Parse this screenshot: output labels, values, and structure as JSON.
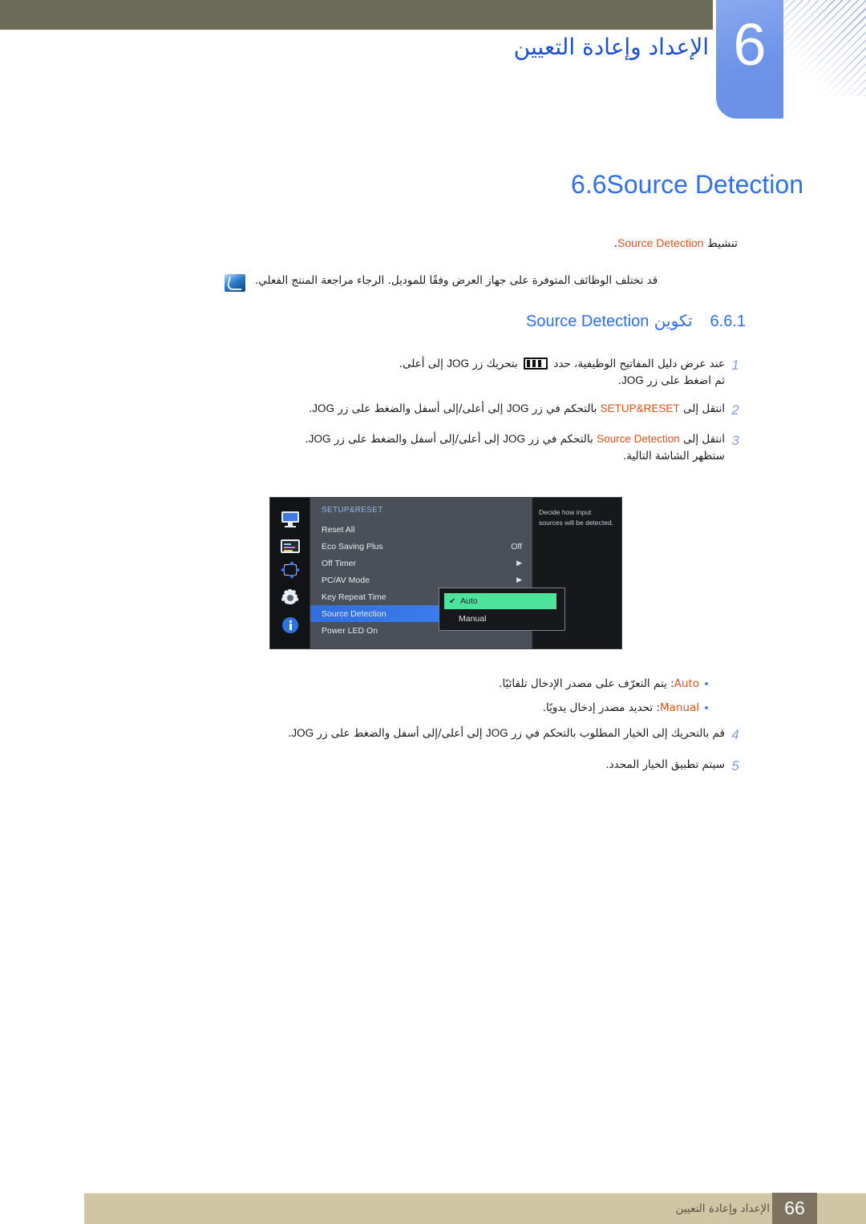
{
  "header": {
    "chapter_number": "6",
    "chapter_title": "الإعداد وإعادة التعيين"
  },
  "section": {
    "number": "6.6",
    "title_en": "Source Detection",
    "subtitle_ar": "تنشيط",
    "subtitle_en": "Source Detection",
    "subtitle_period": "."
  },
  "note": {
    "icon": "note-icon",
    "text": "قد تختلف الوظائف المتوفرة على جهاز العرض وفقًا للموديل. الرجاء مراجعة المنتج الفعلي."
  },
  "subsection": {
    "number": "6.6.1",
    "title_ar": "تكوين",
    "title_en": "Source Detection"
  },
  "steps_top": [
    {
      "num": "1",
      "line1_a": "عند عرض دليل المفاتيح الوظيفية، حدد",
      "line1_b": "بتحريك زر",
      "line1_en": "JOG",
      "line1_c": "إلى أعلى.",
      "line2_a": "ثم اضغط على زر",
      "line2_en": "JOG",
      "line2_b": "."
    },
    {
      "num": "2",
      "line1_a": "انتقل إلى",
      "line1_hi": "SETUP&RESET",
      "line1_b": "بالتحكم في زر",
      "line1_en": "JOG",
      "line1_c": "إلى أعلى/إلى أسفل والضغط على زر",
      "line1_en2": "JOG",
      "line1_d": "."
    },
    {
      "num": "3",
      "line1_a": "انتقل إلى",
      "line1_hi": "Source Detection",
      "line1_b": "بالتحكم في زر",
      "line1_en": "JOG",
      "line1_c": "إلى أعلى/إلى أسفل والضغط على زر",
      "line1_en2": "JOG",
      "line1_d": ".",
      "line2": "ستظهر الشاشة التالية."
    }
  ],
  "osd": {
    "sidebar_icons": [
      "monitor-icon",
      "picture-list-icon",
      "size-position-icon",
      "gear-icon",
      "info-icon"
    ],
    "menu_title": "SETUP&RESET",
    "rows": [
      {
        "label": "Reset All",
        "value": "",
        "arrow": false,
        "selected": false
      },
      {
        "label": "Eco Saving Plus",
        "value": "Off",
        "arrow": false,
        "selected": false
      },
      {
        "label": "Off Timer",
        "value": "",
        "arrow": true,
        "selected": false
      },
      {
        "label": "PC/AV Mode",
        "value": "",
        "arrow": true,
        "selected": false
      },
      {
        "label": "Key Repeat Time",
        "value": "",
        "arrow": false,
        "selected": false
      },
      {
        "label": "Source Detection",
        "value": "",
        "arrow": false,
        "selected": true
      },
      {
        "label": "Power LED On",
        "value": "",
        "arrow": false,
        "selected": false
      }
    ],
    "arrow_glyph": "▶",
    "check_glyph": "✔",
    "popup": [
      {
        "label": "Auto",
        "checked": true
      },
      {
        "label": "Manual",
        "checked": false
      }
    ],
    "help_text": "Decide how input sources will be detected."
  },
  "bullets": [
    {
      "marker": "•",
      "label_en": "Auto",
      "text_ar": ": يتم التعرّف على مصدر الإدخال تلقائيًا."
    },
    {
      "marker": "•",
      "label_en": "Manual",
      "text_ar": ": تحديد مصدر إدخال يدويًا."
    }
  ],
  "steps_bottom": [
    {
      "num": "4",
      "line1_a": "قم بالتحريك إلى الخيار المطلوب بالتحكم في زر",
      "line1_en": "JOG",
      "line1_b": "إلى أعلى/إلى أسفل والضغط على زر",
      "line1_en2": "JOG",
      "line1_c": "."
    },
    {
      "num": "5",
      "line1_a": "سيتم تطبيق الخيار المحدد.",
      "line1_en": "",
      "line1_b": "",
      "line1_en2": "",
      "line1_c": ""
    }
  ],
  "footer": {
    "page_number": "66",
    "text": "الإعداد وإعادة التعيين"
  },
  "colors": {
    "header_bar": "#6d6c58",
    "chapter_tab": "#6d93e8",
    "heading_blue": "#2f6fe8",
    "accent_orange": "#d9531e",
    "footer_bar": "#d0c5a5",
    "footer_num": "#7d7360",
    "osd_selected": "#3b7ceb",
    "osd_popup_on": "#4ee39b"
  }
}
